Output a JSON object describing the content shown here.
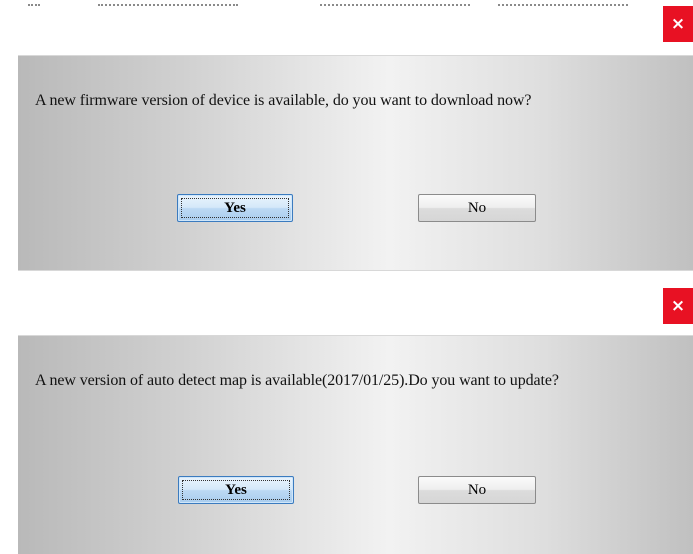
{
  "dialogs": [
    {
      "close_label": "×",
      "message": "A new firmware version of device is available, do you want to download now?",
      "yes_label": "Yes",
      "no_label": "No"
    },
    {
      "close_label": "×",
      "message": "A new version of auto detect map is available(2017/01/25).Do you want to update?",
      "yes_label": "Yes",
      "no_label": "No"
    }
  ],
  "colors": {
    "close_button": "#e81123",
    "default_button_border": "#3b7bbf"
  },
  "icons": {
    "close": "close-icon"
  }
}
